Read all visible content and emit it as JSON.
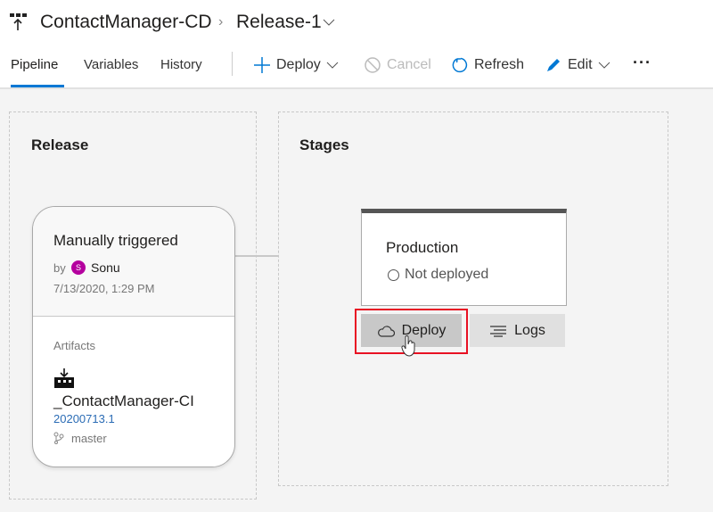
{
  "header": {
    "pipeline_name": "ContactManager-CD",
    "release_name": "Release-1"
  },
  "tabs": [
    {
      "label": "Pipeline",
      "active": true
    },
    {
      "label": "Variables"
    },
    {
      "label": "History"
    }
  ],
  "toolbar": {
    "deploy": "Deploy",
    "cancel": "Cancel",
    "refresh": "Refresh",
    "edit": "Edit",
    "more": "···"
  },
  "release_panel": {
    "title": "Release",
    "trigger": "Manually triggered",
    "by": "by",
    "user": "Sonu",
    "user_initial": "S",
    "timestamp": "7/13/2020, 1:29 PM",
    "artifacts_label": "Artifacts",
    "artifact_name": "_ContactManager-CI",
    "artifact_version": "20200713.1",
    "branch": "master"
  },
  "stages_panel": {
    "title": "Stages",
    "stage_name": "Production",
    "stage_status": "Not deployed",
    "deploy_button": "Deploy",
    "logs_button": "Logs"
  },
  "colors": {
    "accent": "#0078d4",
    "avatar": "#b4009e",
    "highlight": "#e81123"
  }
}
